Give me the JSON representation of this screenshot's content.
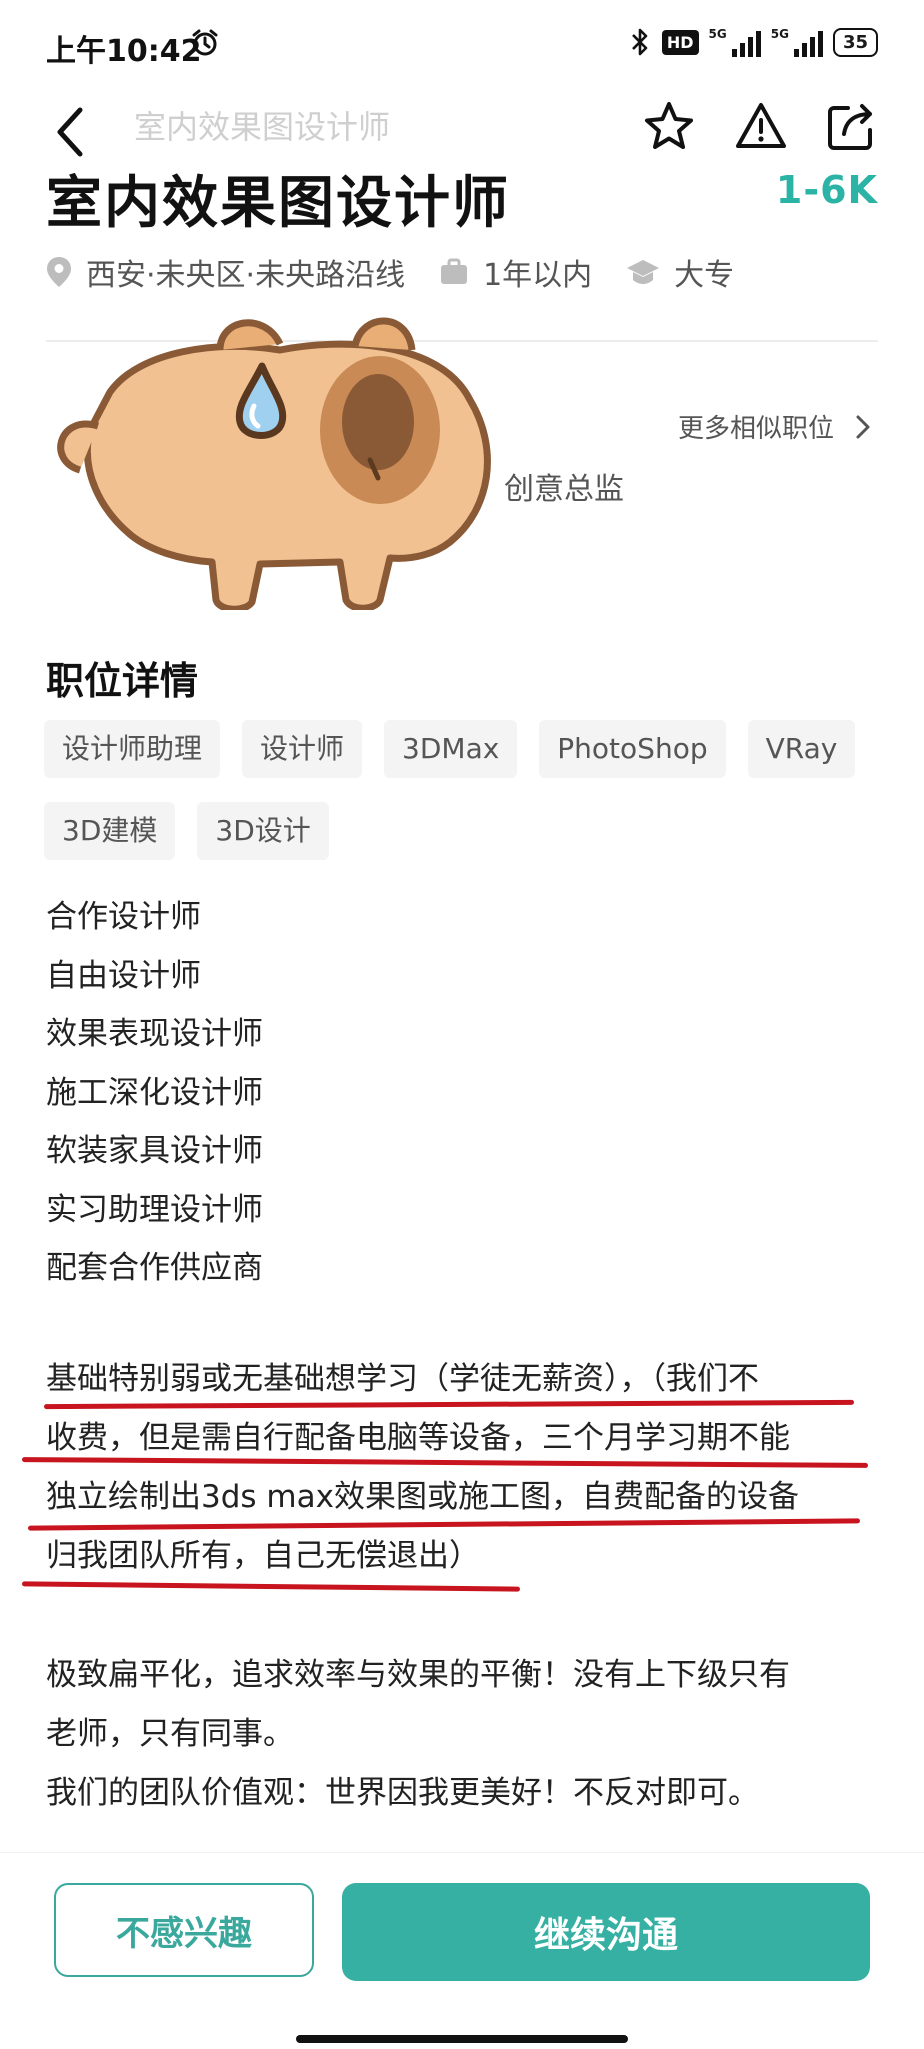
{
  "status_bar": {
    "time": "上午10:42",
    "hd_badge": "HD",
    "network_1": "5G",
    "network_2": "5G",
    "battery": "35"
  },
  "nav": {
    "title": "室内效果图设计师"
  },
  "job": {
    "title": "室内效果图设计师",
    "salary": "1-6K",
    "location": "西安·未央区·未央路沿线",
    "experience": "1年以内",
    "education": "大专"
  },
  "recruiter": {
    "more_similar": "更多相似职位",
    "role": "创意总监"
  },
  "details": {
    "section_title": "职位详情",
    "tags_row1": [
      "设计师助理",
      "设计师",
      "3DMax",
      "PhotoShop",
      "VRay"
    ],
    "tags_row2": [
      "3D建模",
      "3D设计"
    ],
    "positions": [
      "合作设计师",
      "自由设计师",
      "效果表现设计师",
      "施工深化设计师",
      "软装家具设计师",
      "实习助理设计师",
      "配套合作供应商"
    ],
    "paragraph1": [
      "基础特别弱或无基础想学习（学徒无薪资），（我们不",
      "收费，但是需自行配备电脑等设备，三个月学习期不能",
      "独立绘制出3ds max效果图或施工图，自费配备的设备",
      "归我团队所有，自己无偿退出）"
    ],
    "paragraph2": [
      "极致扁平化，追求效率与效果的平衡！没有上下级只有",
      "老师，只有同事。",
      "我们的团队价值观：世界因我更美好！不反对即可。"
    ]
  },
  "actions": {
    "not_interested": "不感兴趣",
    "continue_chat": "继续沟通"
  },
  "colors": {
    "accent": "#35b0a2",
    "salary": "#2bb3a5",
    "annotation": "#c8141e"
  },
  "icons": [
    "back-icon",
    "star-icon",
    "report-icon",
    "share-icon",
    "location-icon",
    "briefcase-icon",
    "graduation-cap-icon",
    "chevron-right-icon"
  ]
}
